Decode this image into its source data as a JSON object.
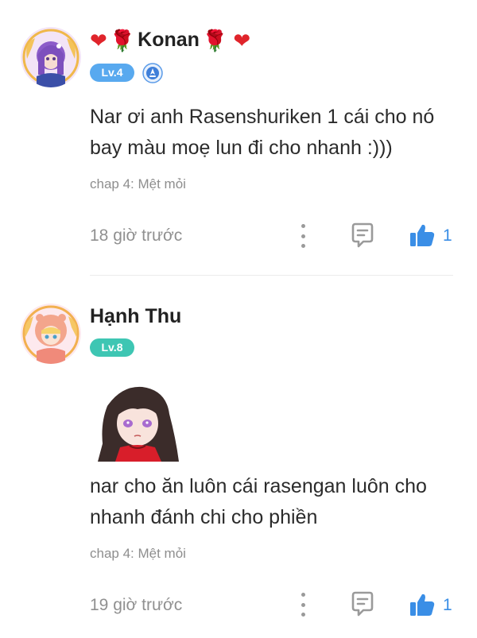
{
  "colors": {
    "level_lv4": "#58a9ef",
    "level_lv8": "#3ec6b3",
    "like_blue": "#3a8ee6",
    "muted_text": "#909090",
    "heart_red": "#e0242b"
  },
  "comments": [
    {
      "name": "Konan",
      "name_decorations": [
        "❤",
        "🌹",
        "🌹",
        "❤"
      ],
      "level": "Lv.4",
      "has_rank_badge": true,
      "text": "Nar ơi anh Rasenshuriken 1 cái cho nó bay màu moẹ lun đi cho nhanh :)))",
      "chapter": "chap 4: Mệt mỏi",
      "time": "18 giờ trước",
      "likes": "1",
      "icons": [
        "avatar",
        "rank-badge-icon",
        "more-icon",
        "reply-icon",
        "like-icon"
      ]
    },
    {
      "name": "Hạnh Thu",
      "level": "Lv.8",
      "has_sticker": true,
      "text": "nar cho ăn luôn cái rasengan luôn cho nhanh đánh chi cho phiền",
      "chapter": "chap 4: Mệt mỏi",
      "time": "19 giờ trước",
      "likes": "1",
      "icons": [
        "avatar",
        "sticker-image",
        "more-icon",
        "reply-icon",
        "like-icon"
      ]
    }
  ]
}
